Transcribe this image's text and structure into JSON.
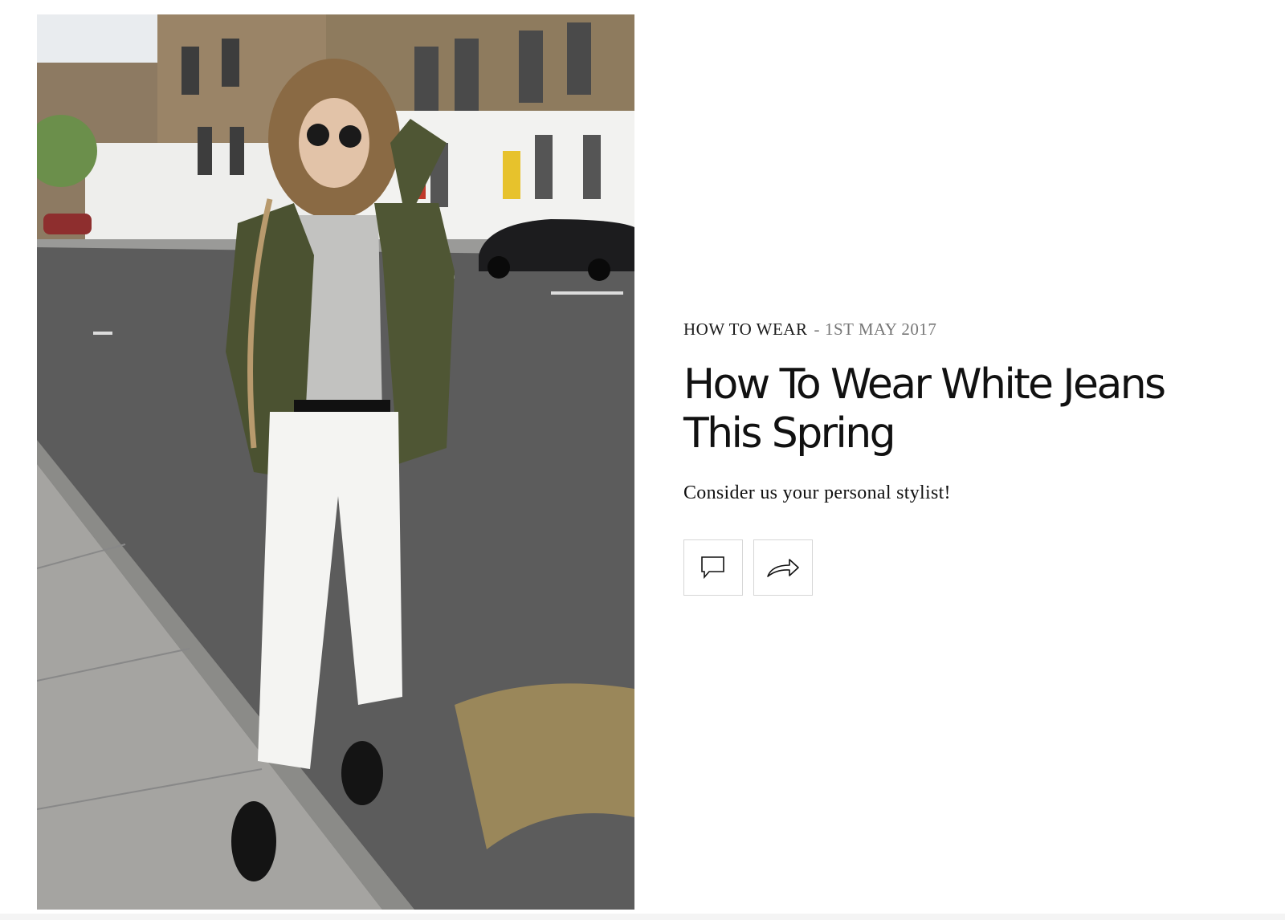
{
  "hero_image": {
    "description_icon": "street-style-photo"
  },
  "article": {
    "category": "HOW TO WEAR",
    "separator": "-",
    "date": "1ST MAY 2017",
    "title": "How To Wear White Jeans This Spring",
    "subtitle": "Consider us your personal stylist!"
  },
  "actions": {
    "comment_icon": "comment-icon",
    "share_icon": "share-icon"
  },
  "colors": {
    "text": "#111111",
    "muted": "#777777",
    "border": "#d6d6d6",
    "background": "#ffffff"
  }
}
